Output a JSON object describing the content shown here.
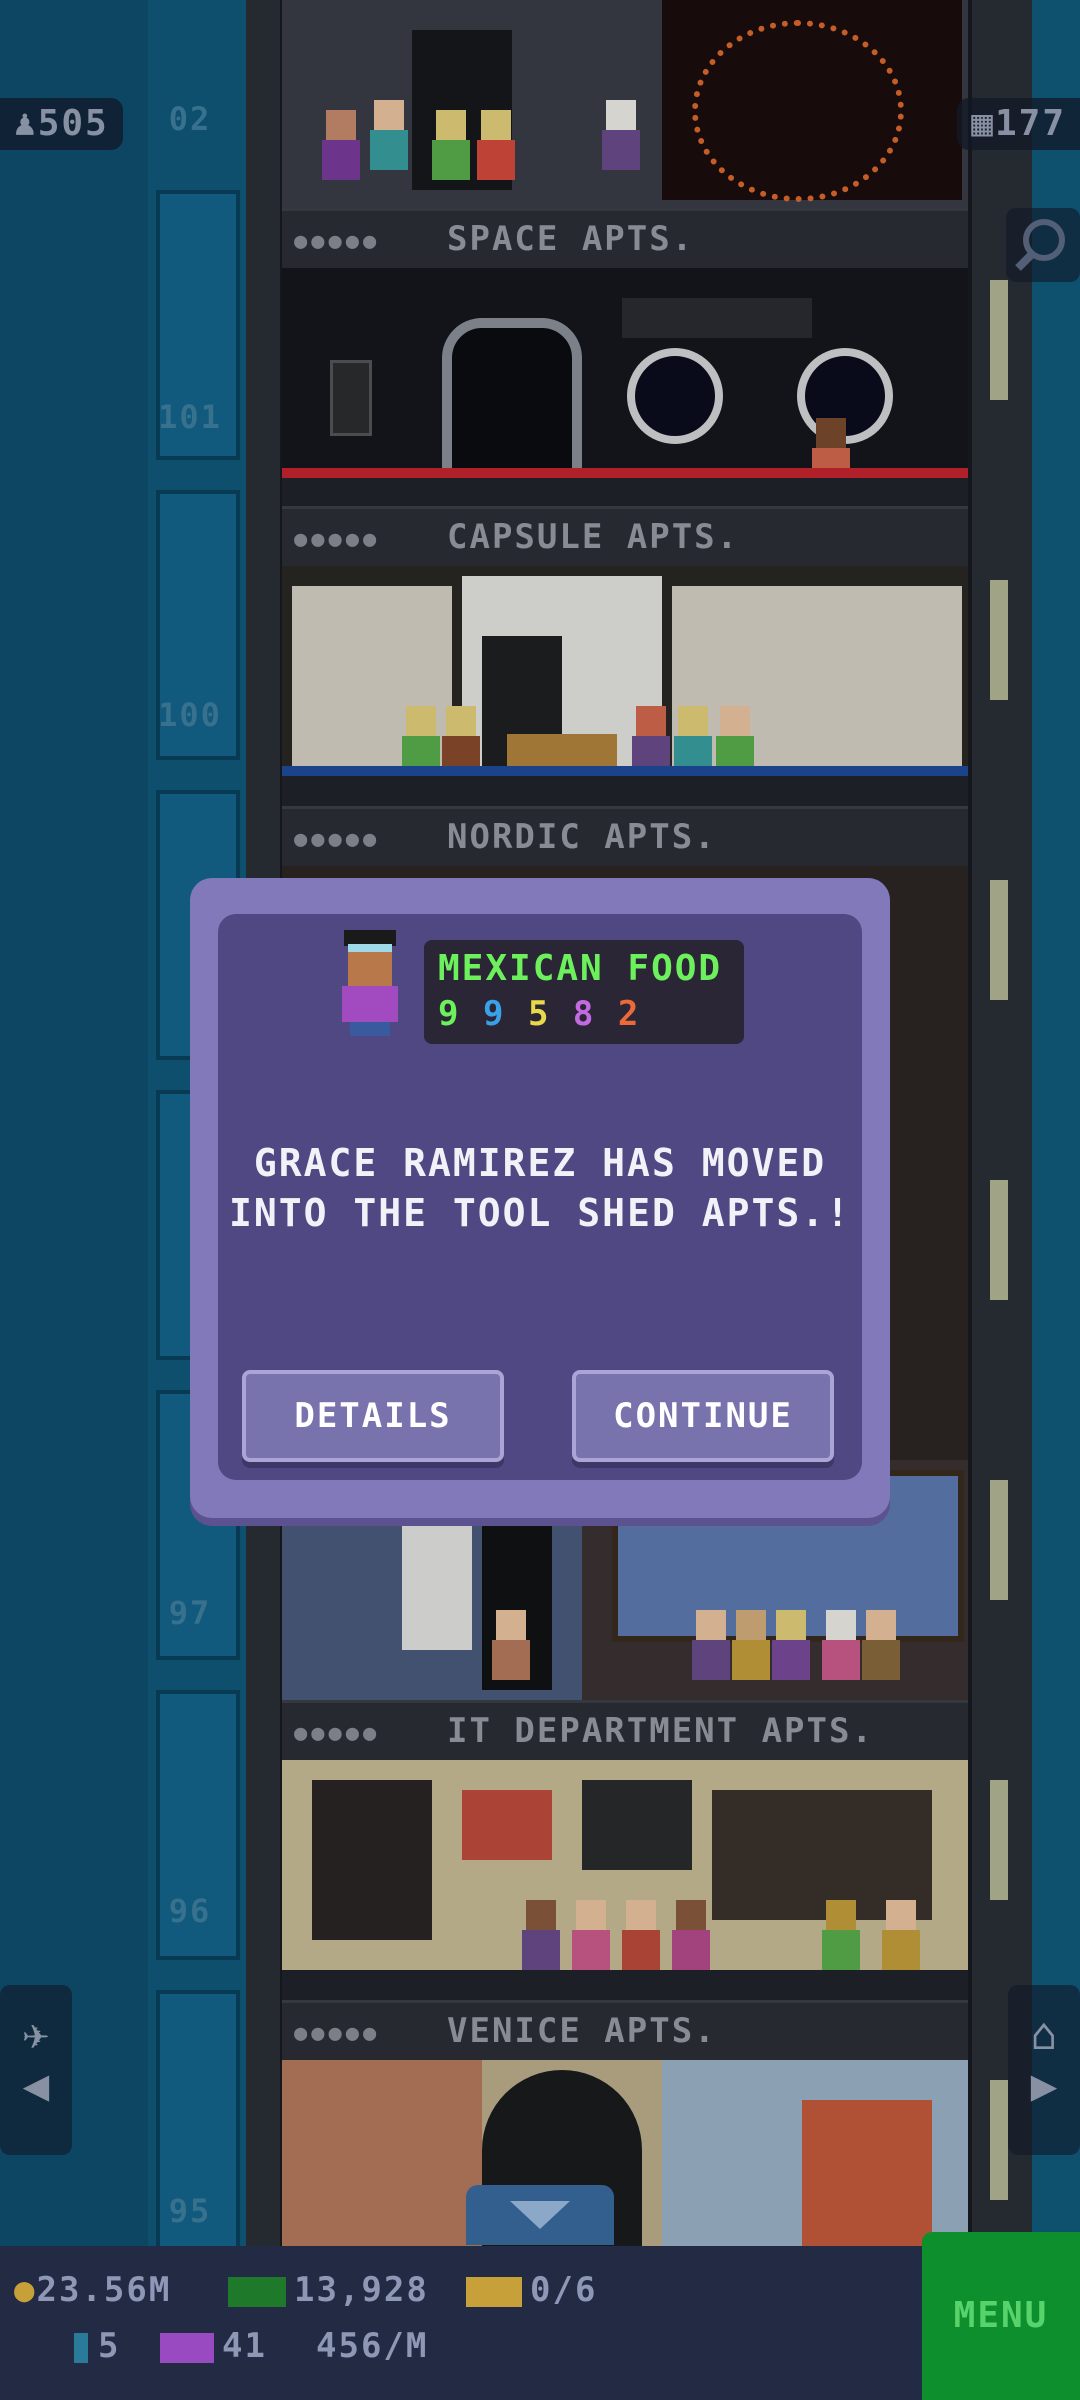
{
  "top_stats": {
    "population": "505",
    "floors_count": "177"
  },
  "floors": {
    "f102_partial": "02",
    "f101": "101",
    "f100": "100",
    "f97": "97",
    "f96": "96",
    "f95": "95"
  },
  "floor_labels": {
    "space": "SPACE APTS.",
    "capsule": "CAPSULE APTS.",
    "nordic": "NORDIC APTS.",
    "it_dept": "IT DEPARTMENT APTS.",
    "venice": "VENICE APTS.",
    "occupancy_dots": "●●●●●"
  },
  "dialog": {
    "job": "MEXICAN FOOD",
    "job_stats": [
      "9",
      "9",
      "5",
      "8",
      "2"
    ],
    "job_stat_colors": [
      "#6cf05c",
      "#3aa0e8",
      "#e8d84a",
      "#c46ae0",
      "#ec6a3a"
    ],
    "message_line1": "GRACE RAMIREZ HAS MOVED",
    "message_line2": "INTO THE TOOL SHED APTS.!",
    "details_label": "DETAILS",
    "continue_label": "CONTINUE"
  },
  "bottom_bar": {
    "coins": "23.56M",
    "bux": "13,928",
    "tickets": "0/6",
    "items": "5",
    "vip": "41",
    "rate": "456/M",
    "menu_label": "MENU"
  },
  "icons": {
    "population": "person-icon",
    "floors": "building-icon",
    "search": "magnifier-icon",
    "elevator": "elevator-icon",
    "home": "home-icon"
  }
}
